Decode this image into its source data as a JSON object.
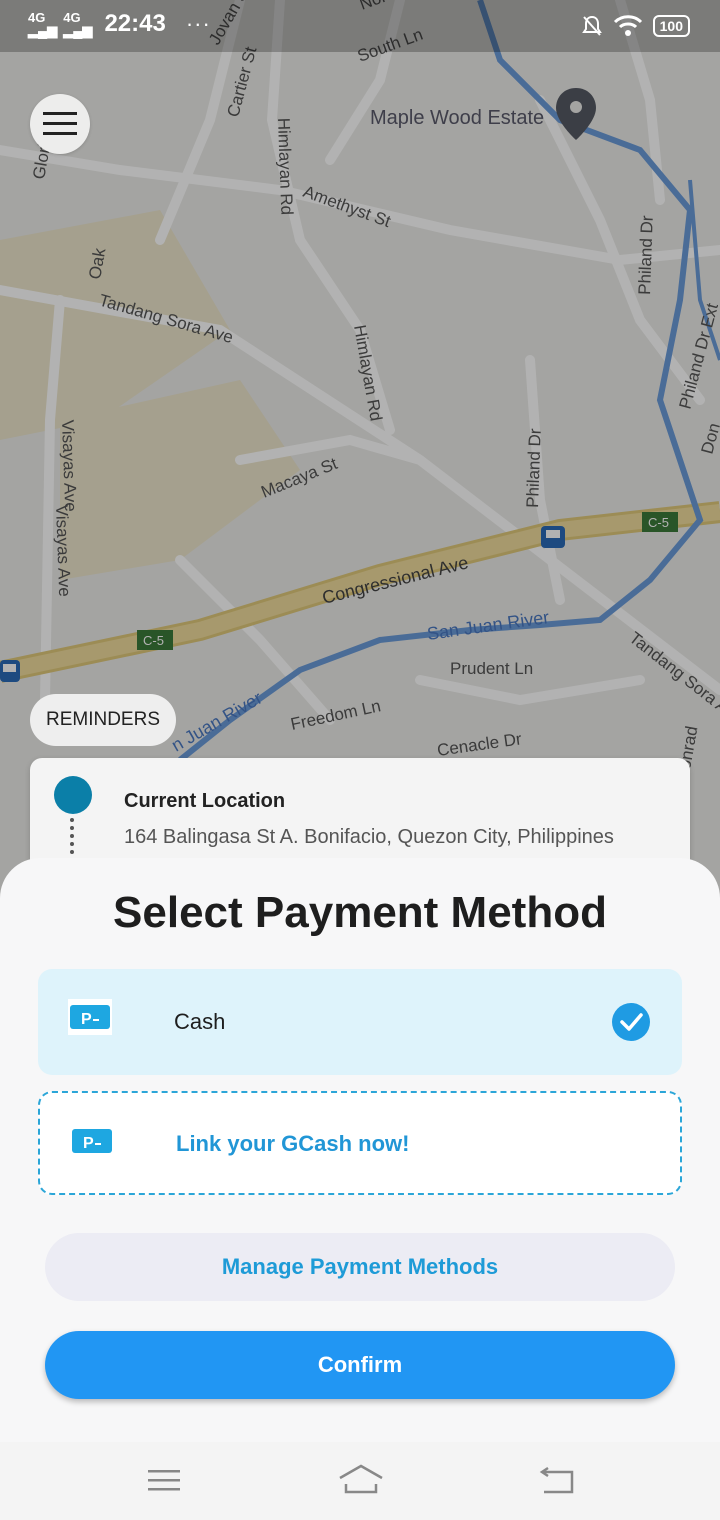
{
  "status_bar": {
    "network1": "4G",
    "network2": "4G",
    "time": "22:43",
    "more": "···",
    "battery": "100"
  },
  "map": {
    "labels": {
      "south_ln": "South Ln",
      "north": "Nor",
      "maple_wood": "Maple Wood Estate",
      "cartier": "Cartier St",
      "jovan": "Jovan S",
      "gloria": "Gloria",
      "himlayan1": "Himlayan Rd",
      "amethyst": "Amethyst St",
      "philand_dr": "Philand Dr",
      "oak": "Oak",
      "tandang_sora": "Tandang Sora Ave",
      "himlayan2": "Himlayan Rd",
      "philand_dr_ext": "Philand Dr Ext",
      "visayas1": "Visayas Ave",
      "macaya": "Macaya St",
      "philand_dr2": "Philand Dr",
      "don": "Don",
      "c5_right": "C-5",
      "visayas2": "Visayas Ave",
      "congressional": "Congressional Ave",
      "san_juan": "San Juan River",
      "c5_left": "C-5",
      "prudent": "Prudent Ln",
      "tandang_sora2": "Tandang Sora A",
      "san_juan2": "n Juan River",
      "freedom": "Freedom Ln",
      "cenacle": "Cenacle Dr",
      "conrad": "onrad"
    }
  },
  "reminders_label": "REMINDERS",
  "location_card": {
    "title": "Current Location",
    "address": "164 Balingasa St A. Bonifacio, Quezon City, Philippines"
  },
  "sheet": {
    "title": "Select Payment Method",
    "options": [
      {
        "label": "Cash",
        "selected": true
      },
      {
        "label": "Link your GCash now!",
        "selected": false
      }
    ],
    "manage_label": "Manage Payment Methods",
    "confirm_label": "Confirm"
  },
  "colors": {
    "accent": "#2196f3",
    "link": "#1e9bd7",
    "selected_bg": "#def3fb"
  }
}
